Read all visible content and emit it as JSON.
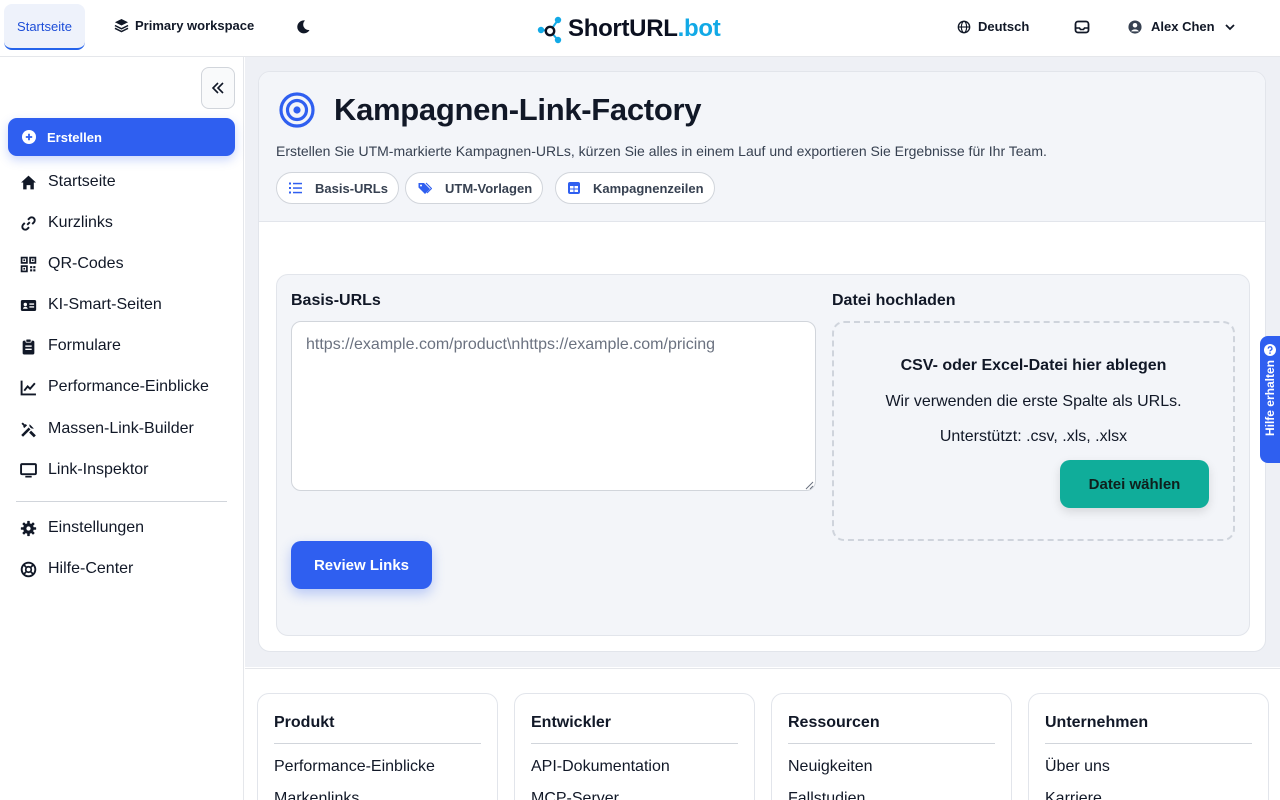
{
  "header": {
    "home_tab": "Startseite",
    "workspace": "Primary workspace",
    "logo_part1": "Short",
    "logo_part2": "URL",
    "logo_part3": ".bot",
    "language": "Deutsch",
    "user_name": "Alex Chen"
  },
  "sidebar": {
    "create_label": "Erstellen",
    "items": [
      {
        "label": "Startseite",
        "icon": "home-icon"
      },
      {
        "label": "Kurzlinks",
        "icon": "link-icon"
      },
      {
        "label": "QR-Codes",
        "icon": "qr-code-icon"
      },
      {
        "label": "KI-Smart-Seiten",
        "icon": "id-card-icon"
      },
      {
        "label": "Formulare",
        "icon": "clipboard-icon"
      },
      {
        "label": "Performance-Einblicke",
        "icon": "chart-line-icon"
      },
      {
        "label": "Massen-Link-Builder",
        "icon": "tools-icon"
      },
      {
        "label": "Link-Inspektor",
        "icon": "monitor-icon"
      }
    ],
    "bottom_items": [
      {
        "label": "Einstellungen",
        "icon": "gear-icon"
      },
      {
        "label": "Hilfe-Center",
        "icon": "lifebuoy-icon"
      }
    ]
  },
  "page": {
    "title": "Kampagnen-Link-Factory",
    "subtitle": "Erstellen Sie UTM-markierte Kampagnen-URLs, kürzen Sie alles in einem Lauf und exportieren Sie Ergebnisse für Ihr Team.",
    "chips": [
      "Basis-URLs",
      "UTM-Vorlagen",
      "Kampagnenzeilen"
    ],
    "base_urls_label": "Basis-URLs",
    "base_urls_placeholder": "https://example.com/product\\nhttps://example.com/pricing",
    "upload_label": "Datei hochladen",
    "dropzone_title": "CSV- oder Excel-Datei hier ablegen",
    "dropzone_line1": "Wir verwenden die erste Spalte als URLs.",
    "dropzone_line2": "Unterstützt: .csv, .xls, .xlsx",
    "file_button": "Datei wählen",
    "review_button": "Review Links"
  },
  "help_tab": "Hilfe erhalten",
  "footer": {
    "columns": [
      {
        "heading": "Produkt",
        "links": [
          "Performance-Einblicke",
          "Markenlinks"
        ]
      },
      {
        "heading": "Entwickler",
        "links": [
          "API-Dokumentation",
          "MCP-Server"
        ]
      },
      {
        "heading": "Ressourcen",
        "links": [
          "Neuigkeiten",
          "Fallstudien"
        ]
      },
      {
        "heading": "Unternehmen",
        "links": [
          "Über uns",
          "Karriere"
        ]
      }
    ]
  },
  "colors": {
    "primary": "#2f5ff0",
    "teal": "#10ad9a",
    "logo_blue": "#12a9e6"
  }
}
